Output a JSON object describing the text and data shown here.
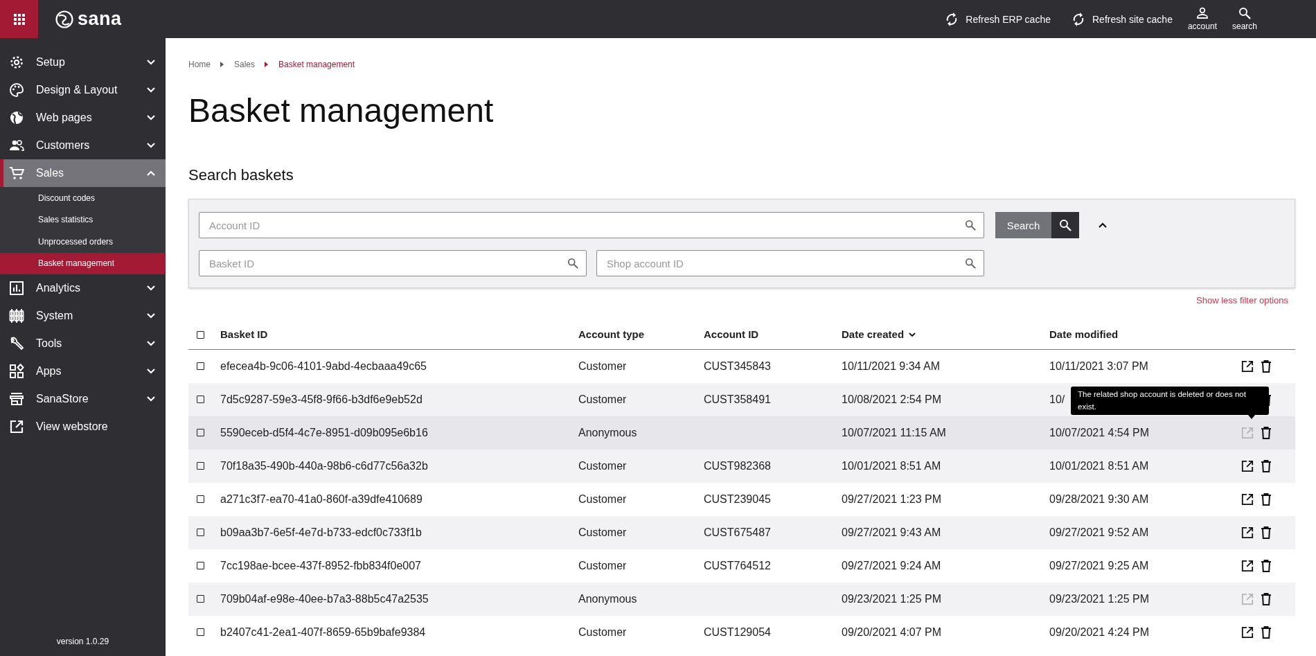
{
  "topbar": {
    "logo": "sana",
    "actions": [
      {
        "kind": "refresh",
        "label": "Refresh ERP cache"
      },
      {
        "kind": "refresh",
        "label": "Refresh site cache"
      },
      {
        "kind": "account",
        "label": "account"
      },
      {
        "kind": "search",
        "label": "search"
      }
    ]
  },
  "sidebar": {
    "items": [
      {
        "label": "Setup",
        "kind": "group",
        "expanded": false,
        "selected": false
      },
      {
        "label": "Design & Layout",
        "kind": "group",
        "expanded": false,
        "selected": false
      },
      {
        "label": "Web pages",
        "kind": "group",
        "expanded": false,
        "selected": false
      },
      {
        "label": "Customers",
        "kind": "group",
        "expanded": false,
        "selected": false
      },
      {
        "label": "Sales",
        "kind": "group",
        "expanded": true,
        "selected": true,
        "children": [
          {
            "label": "Discount codes",
            "selected": false
          },
          {
            "label": "Sales statistics",
            "selected": false
          },
          {
            "label": "Unprocessed orders",
            "selected": false
          },
          {
            "label": "Basket management",
            "selected": true
          }
        ]
      },
      {
        "label": "Analytics",
        "kind": "group",
        "expanded": false,
        "selected": false
      },
      {
        "label": "System",
        "kind": "group",
        "expanded": false,
        "selected": false
      },
      {
        "label": "Tools",
        "kind": "group",
        "expanded": false,
        "selected": false
      },
      {
        "label": "Apps",
        "kind": "group",
        "expanded": false,
        "selected": false
      },
      {
        "label": "SanaStore",
        "kind": "group",
        "expanded": false,
        "selected": false
      },
      {
        "label": "View webstore",
        "kind": "link",
        "selected": false
      }
    ],
    "version": "version 1.0.29"
  },
  "breadcrumb": [
    {
      "label": "Home",
      "current": false
    },
    {
      "label": "Sales",
      "current": false
    },
    {
      "label": "Basket management",
      "current": true
    }
  ],
  "title": "Basket management",
  "search": {
    "heading": "Search baskets",
    "fields": [
      {
        "placeholder": "Account ID"
      },
      {
        "placeholder": "Basket ID"
      },
      {
        "placeholder": "Shop account ID"
      }
    ],
    "button": "Search",
    "expanded": true,
    "toggle_link": "Show less filter options"
  },
  "table": {
    "select_all_checked": false,
    "columns": [
      {
        "label": "Basket ID",
        "sorted": false
      },
      {
        "label": "Account type",
        "sorted": false
      },
      {
        "label": "Account ID",
        "sorted": false
      },
      {
        "label": "Date created",
        "sorted": true
      },
      {
        "label": "Date modified",
        "sorted": false
      }
    ],
    "rows": [
      {
        "checked": false,
        "hovered": false,
        "cells": [
          "efecea4b-9c06-4101-9abd-4ecbaaa49c65",
          "Customer",
          "CUST345843",
          "10/11/2021 9:34 AM",
          "10/11/2021 3:07 PM"
        ],
        "link_enabled": true
      },
      {
        "checked": false,
        "hovered": false,
        "cells": [
          "7d5c9287-59e3-45f8-9f66-b3df6e9eb52d",
          "Customer",
          "CUST358491",
          "10/08/2021 2:54 PM",
          "10/"
        ]
      },
      {
        "checked": false,
        "hovered": true,
        "cells": [
          "5590eceb-d5f4-4c7e-8951-d09b095e6b16",
          "Anonymous",
          "",
          "10/07/2021 11:15 AM",
          "10/07/2021 4:54 PM"
        ],
        "link_enabled": false,
        "tooltip": "The related shop account is deleted or does not exist."
      },
      {
        "checked": false,
        "hovered": false,
        "cells": [
          "70f18a35-490b-440a-98b6-c6d77c56a32b",
          "Customer",
          "CUST982368",
          "10/01/2021 8:51 AM",
          "10/01/2021 8:51 AM"
        ],
        "link_enabled": true
      },
      {
        "checked": false,
        "hovered": false,
        "cells": [
          "a271c3f7-ea70-41a0-860f-a39dfe410689",
          "Customer",
          "CUST239045",
          "09/27/2021 1:23 PM",
          "09/28/2021 9:30 AM"
        ],
        "link_enabled": true
      },
      {
        "checked": false,
        "hovered": false,
        "cells": [
          "b09aa3b7-6e5f-4e7d-b733-edcf0c733f1b",
          "Customer",
          "CUST675487",
          "09/27/2021 9:43 AM",
          "09/27/2021 9:52 AM"
        ],
        "link_enabled": true
      },
      {
        "checked": false,
        "hovered": false,
        "cells": [
          "7cc198ae-bcee-437f-8952-fbb834f0e007",
          "Customer",
          "CUST764512",
          "09/27/2021 9:24 AM",
          "09/27/2021 9:25 AM"
        ],
        "link_enabled": true
      },
      {
        "checked": false,
        "hovered": false,
        "cells": [
          "709b04af-e98e-40ee-b7a3-88b5c47a2535",
          "Anonymous",
          "",
          "09/23/2021 1:25 PM",
          "09/23/2021 1:25 PM"
        ],
        "link_enabled": false
      },
      {
        "checked": false,
        "hovered": false,
        "cells": [
          "b2407c41-2ea1-407f-8659-65b9bafe9384",
          "Customer",
          "CUST129054",
          "09/20/2021 4:07 PM",
          "09/20/2021 4:24 PM"
        ],
        "link_enabled": true
      }
    ]
  }
}
